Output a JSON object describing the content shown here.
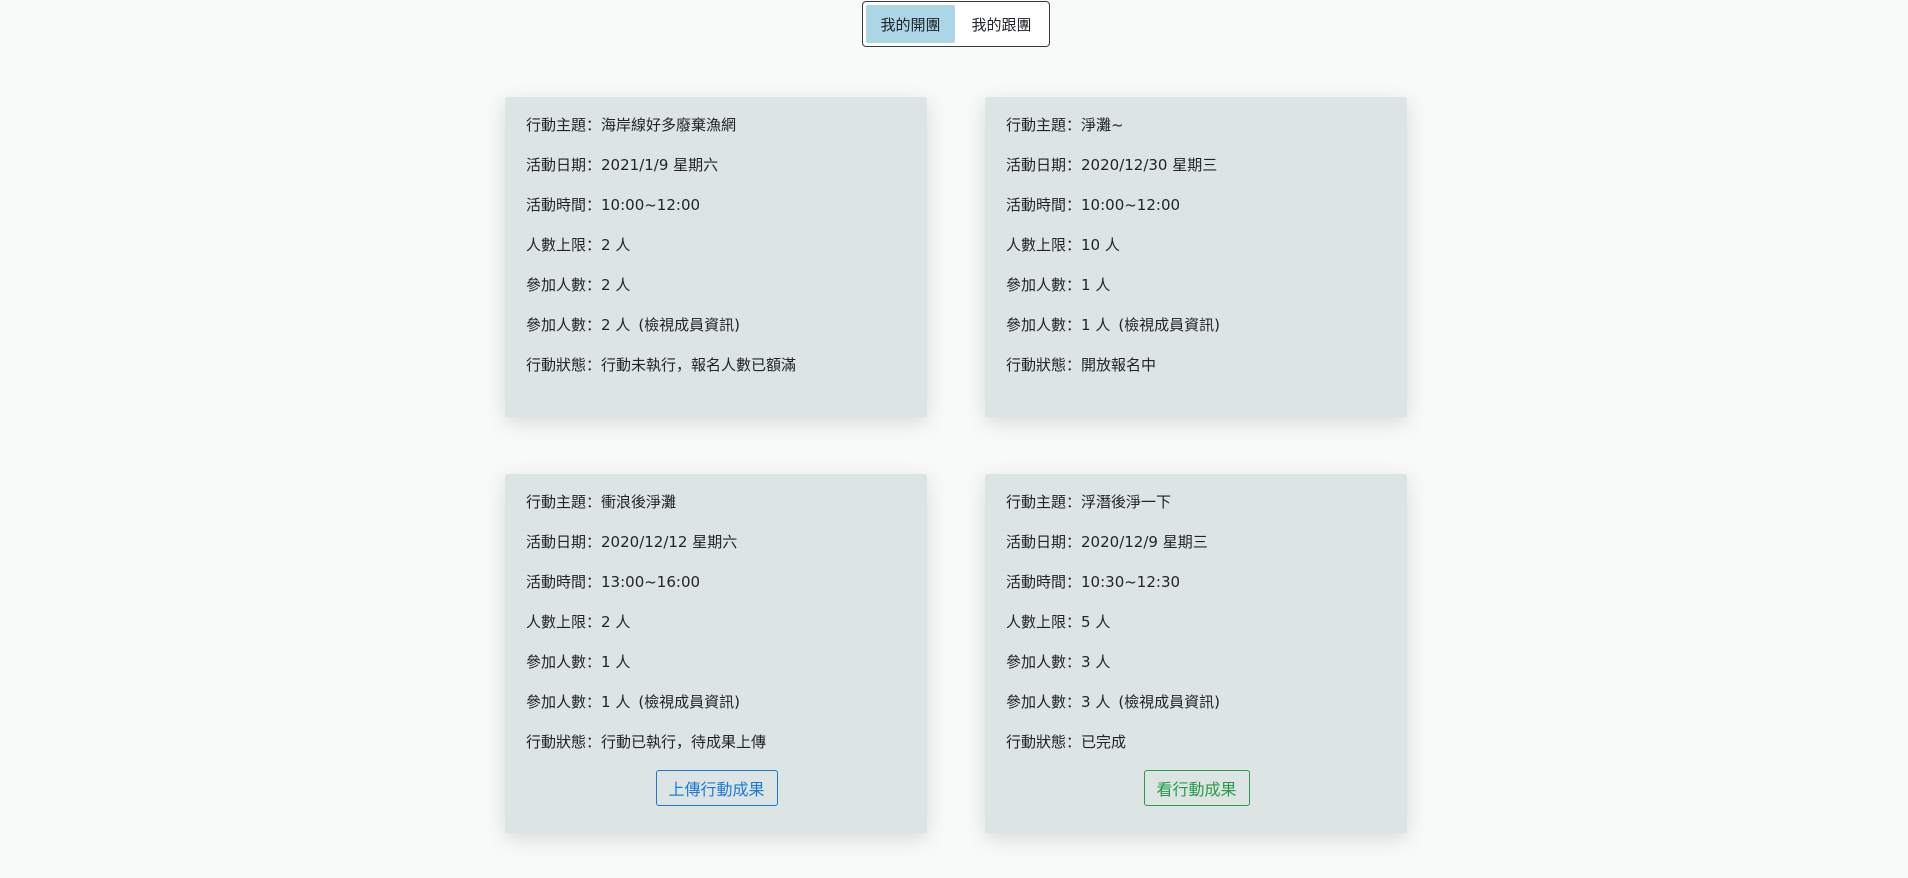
{
  "tabs": [
    {
      "label": "我的開團",
      "active": true
    },
    {
      "label": "我的跟團",
      "active": false
    }
  ],
  "field_labels": {
    "topic": "行動主題：",
    "date": "活動日期：",
    "time": "活動時間：",
    "limit": "人數上限：",
    "joined": "參加人數：",
    "members": "參加人數：",
    "status": "行動狀態："
  },
  "member_link_text": "(檢視成員資訊)",
  "colors": {
    "page_bg": "#f8faf9",
    "card_bg": "#dce4e4",
    "active_tab": "#acd6e5",
    "upload_button": "#1a7ad9",
    "view_button": "#2a9a48"
  },
  "cards": [
    {
      "topic": "海岸線好多廢棄漁網",
      "date": "2021/1/9 星期六",
      "time": "10:00~12:00",
      "limit": "2 人",
      "joined": "2 人",
      "members": "2 人",
      "status": "行動未執行，報名人數已額滿"
    },
    {
      "topic": "淨灘~",
      "date": "2020/12/30 星期三",
      "time": "10:00~12:00",
      "limit": "10 人",
      "joined": "1 人",
      "members": "1 人",
      "status": "開放報名中"
    },
    {
      "topic": "衝浪後淨灘",
      "date": "2020/12/12 星期六",
      "time": "13:00~16:00",
      "limit": "2 人",
      "joined": "1 人",
      "members": "1 人",
      "status": "行動已執行，待成果上傳",
      "button": "上傳行動成果"
    },
    {
      "topic": "浮潛後淨一下",
      "date": "2020/12/9 星期三",
      "time": "10:30~12:30",
      "limit": "5 人",
      "joined": "3 人",
      "members": "3 人",
      "status": "已完成",
      "button": "看行動成果"
    }
  ]
}
